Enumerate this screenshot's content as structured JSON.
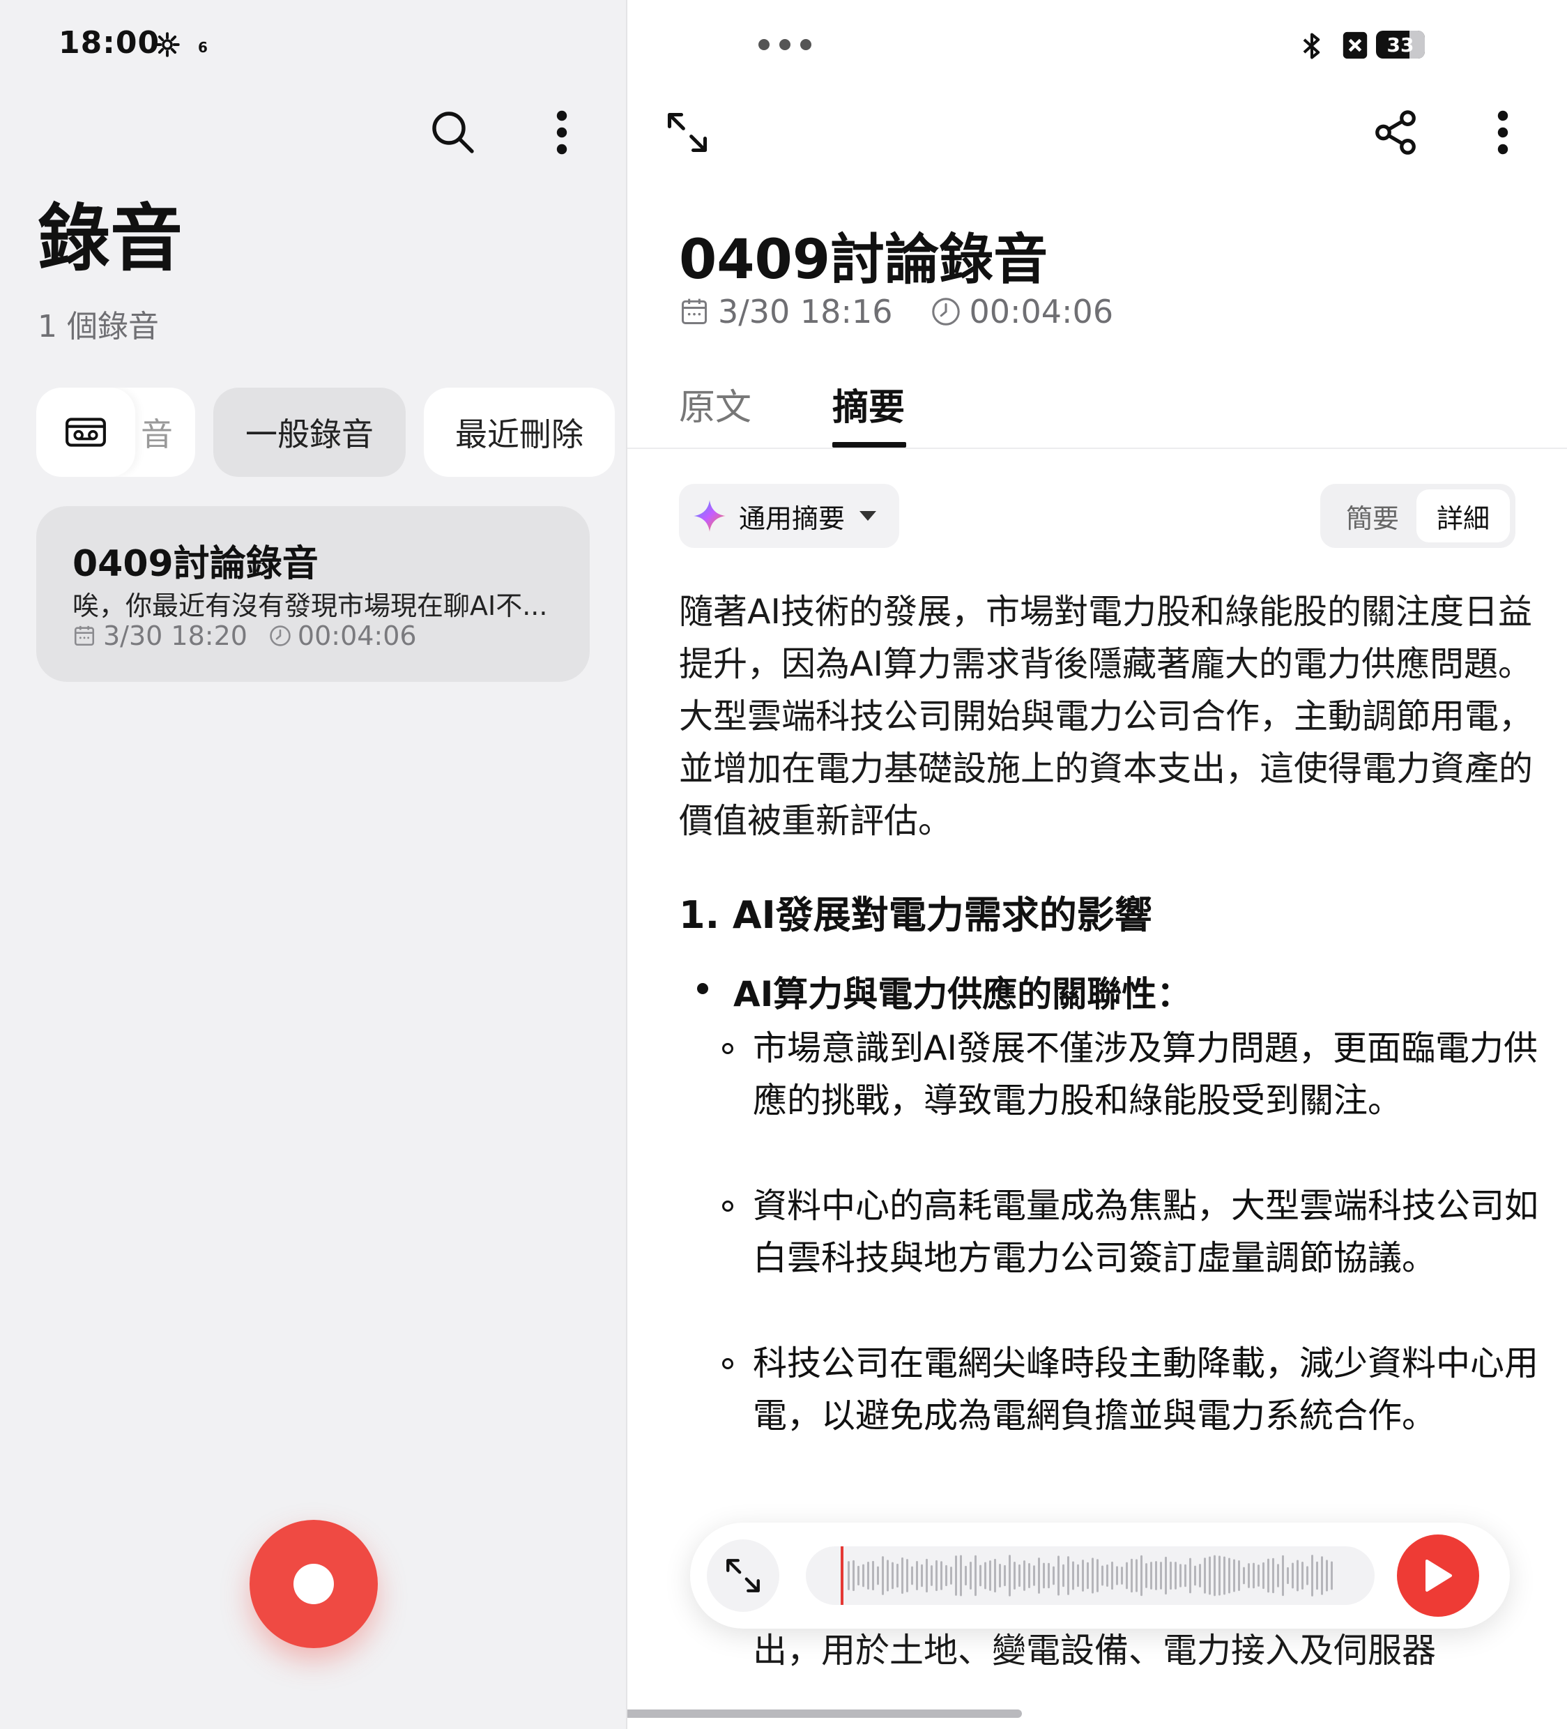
{
  "status": {
    "time": "18:00",
    "notif_count": "6",
    "battery": "33"
  },
  "left": {
    "title": "錄音",
    "count": "1 個錄音",
    "chips": [
      {
        "label": "音"
      },
      {
        "label": "一般錄音"
      },
      {
        "label": "最近刪除"
      }
    ],
    "recording": {
      "title": "0409討論錄音",
      "snippet": "唉，你最近有沒有發現市場現在聊AI不...",
      "date": "3/30 18:20",
      "duration": "00:04:06"
    }
  },
  "right": {
    "title": "0409討論錄音",
    "date": "3/30 18:16",
    "duration": "00:04:06",
    "tabs": [
      "原文",
      "摘要"
    ],
    "active_tab": "摘要",
    "summary_type": "通用摘要",
    "segments": [
      "簡要",
      "詳細"
    ],
    "active_segment": "詳細",
    "intro": "隨著AI技術的發展，市場對電力股和綠能股的關注度日益提升，因為AI算力需求背後隱藏著龐大的電力供應問題。大型雲端科技公司開始與電力公司合作，主動調節用電，並增加在電力基礎設施上的資本支出，這使得電力資產的價值被重新評估。",
    "section_heading": "1. AI發展對電力需求的影響",
    "bullet_heading": "AI算力與電力供應的關聯性：",
    "sub_bullets": [
      "市場意識到AI發展不僅涉及算力問題，更面臨電力供應的挑戰，導致電力股和綠能股受到關注。",
      "資料中心的高耗電量成為焦點，大型雲端科技公司如白雲科技與地方電力公司簽訂虛量調節協議。",
      "科技公司在電網尖峰時段主動降載，減少資料中心用電，以避免成為電網負擔並與電力系統合作。"
    ],
    "partial_line": "出，用於土地、變電設備、電力接入及伺服器"
  },
  "colors": {
    "accent_red": "#ef4a43",
    "play_red": "#ee3b35"
  }
}
